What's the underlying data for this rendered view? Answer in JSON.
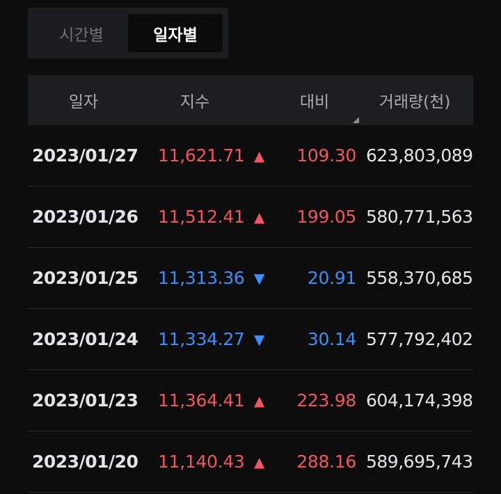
{
  "tabs": {
    "time_label": "시간별",
    "daily_label": "일자별"
  },
  "table": {
    "headers": {
      "date": "일자",
      "index": "지수",
      "change": "대비",
      "volume": "거래량(천)"
    },
    "rows": [
      {
        "date": "2023/01/27",
        "index": "11,621.71",
        "arrow": "▲",
        "change": "109.30",
        "volume": "623,803,089",
        "direction": "up"
      },
      {
        "date": "2023/01/26",
        "index": "11,512.41",
        "arrow": "▲",
        "change": "199.05",
        "volume": "580,771,563",
        "direction": "up"
      },
      {
        "date": "2023/01/25",
        "index": "11,313.36",
        "arrow": "▼",
        "change": "20.91",
        "volume": "558,370,685",
        "direction": "down"
      },
      {
        "date": "2023/01/24",
        "index": "11,334.27",
        "arrow": "▼",
        "change": "30.14",
        "volume": "577,792,402",
        "direction": "down"
      },
      {
        "date": "2023/01/23",
        "index": "11,364.41",
        "arrow": "▲",
        "change": "223.98",
        "volume": "604,174,398",
        "direction": "up"
      },
      {
        "date": "2023/01/20",
        "index": "11,140.43",
        "arrow": "▲",
        "change": "288.16",
        "volume": "589,695,743",
        "direction": "up"
      }
    ]
  },
  "colors": {
    "up": "#f0565e",
    "down": "#3f8ef7",
    "background": "#0d0d0d"
  }
}
